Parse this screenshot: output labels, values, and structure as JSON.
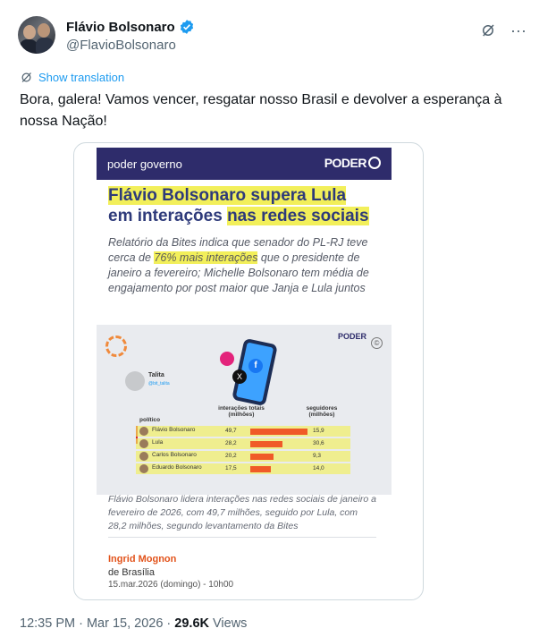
{
  "author": {
    "name": "Flávio Bolsonaro",
    "handle": "@FlavioBolsonaro",
    "verified": true
  },
  "header_icons": [
    "grok-icon",
    "more-icon"
  ],
  "translate_label": "Show translation",
  "tweet_text": "Bora, galera! Vamos vencer, resgatar nosso Brasil e devolver a esperança à nossa Nação!",
  "media": {
    "section": "poder governo",
    "logo": "PODER",
    "headline_pre": "Flávio Bolsonaro supera Lula",
    "headline_mid": "em interações ",
    "headline_hl": "nas redes sociais",
    "deck_pre": "Relatório da Bites indica que senador do PL-RJ teve cerca de ",
    "deck_hl": "76% mais interações",
    "deck_post": " que o presidente de janeiro a fevereiro; Michelle Bolsonaro tem média de engajamento por post maior que Janja e Lula juntos",
    "infographic": {
      "logo": "PODER",
      "copyright": "©",
      "author_name": "Talita",
      "author_handle": "@bit_talita",
      "col_politico": "político",
      "col_interacoes": "interações totais (milhões)",
      "col_seguidores": "seguidores (milhões)",
      "rows": [
        {
          "name": "Flávio Bolsonaro",
          "interacoes": "49,7",
          "seguidores": "15,9",
          "fraction": 1.0
        },
        {
          "name": "Lula",
          "interacoes": "28,2",
          "seguidores": "30,6",
          "fraction": 0.567
        },
        {
          "name": "Carlos Bolsonaro",
          "interacoes": "20,2",
          "seguidores": "9,3",
          "fraction": 0.406
        },
        {
          "name": "Eduardo Bolsonaro",
          "interacoes": "17,5",
          "seguidores": "14,0",
          "fraction": 0.352
        }
      ]
    },
    "caption": "Flávio Bolsonaro lidera interações nas redes sociais de janeiro a fevereiro de 2026, com 49,7 milhões, seguido por Lula, com 28,2 milhões, segundo levantamento da Bites",
    "author": "Ingrid Mognon",
    "author_location": "de Brasília",
    "author_date": "15.mar.2026 (domingo) - 10h00"
  },
  "meta": {
    "time": "12:35 PM · Mar 15, 2026 · ",
    "views_count": "29.6K",
    "views_label": " Views"
  },
  "colors": {
    "link": "#1d9bf0",
    "navy": "#2e2c6b",
    "highlight": "#f2ef5a",
    "bar": "#f05a28",
    "author": "#e2531b"
  }
}
